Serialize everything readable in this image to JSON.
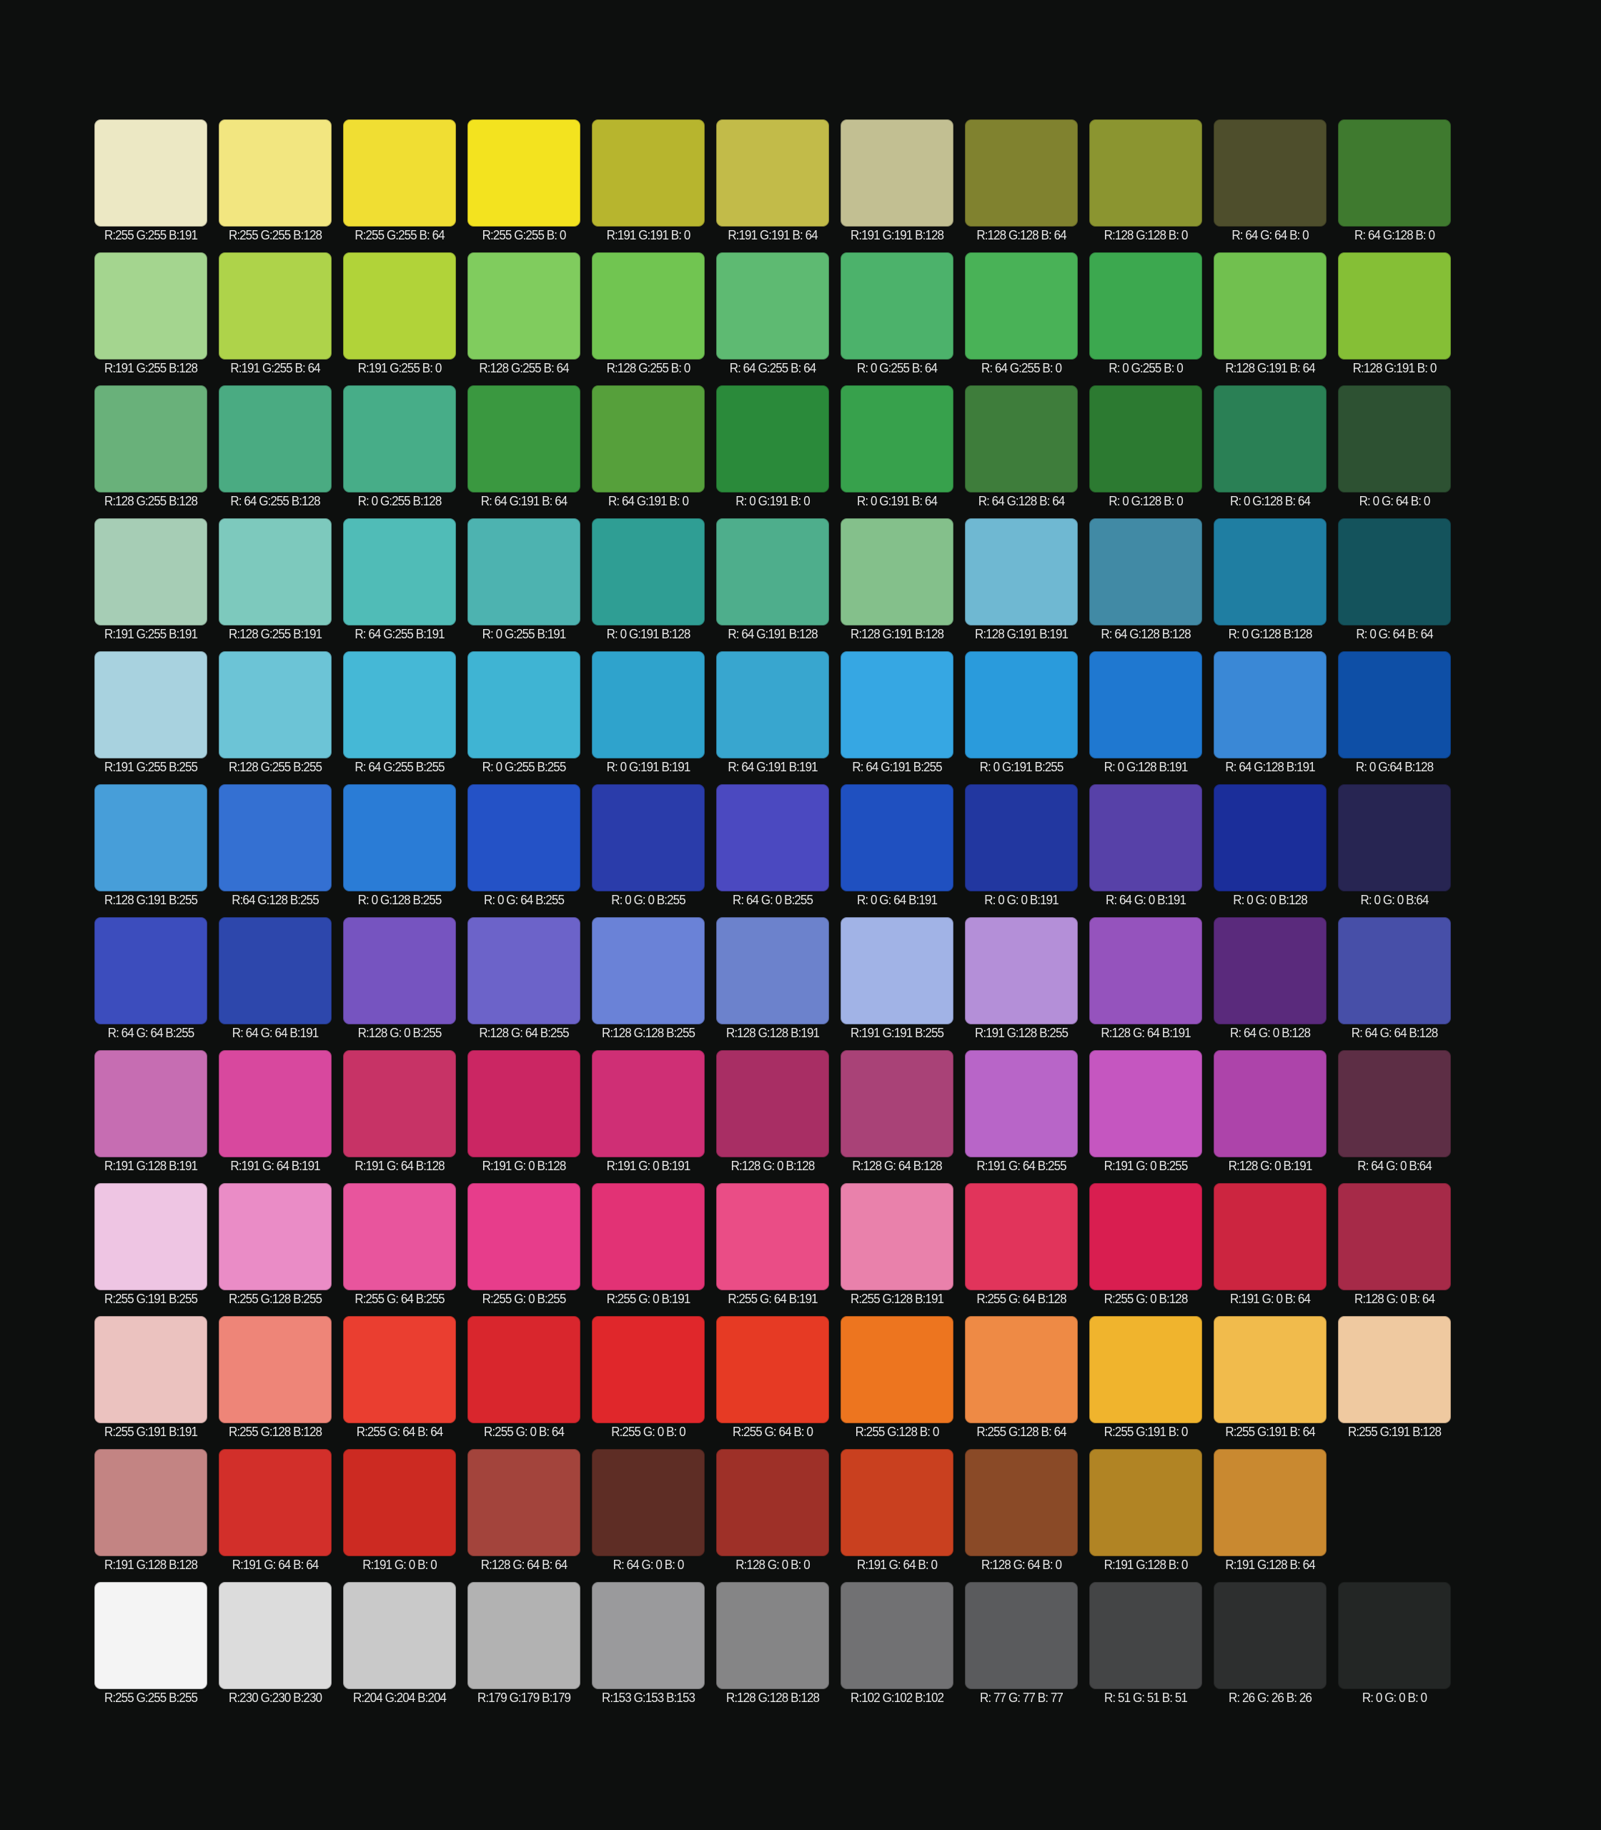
{
  "rows": [
    [
      {
        "label": "R:255 G:255 B:191",
        "color": "#ece8c4"
      },
      {
        "label": "R:255 G:255 B:128",
        "color": "#f2e680"
      },
      {
        "label": "R:255 G:255 B: 64",
        "color": "#f0de33"
      },
      {
        "label": "R:255 G:255 B: 0",
        "color": "#f3e31f"
      },
      {
        "label": "R:191 G:191 B: 0",
        "color": "#b7b52e"
      },
      {
        "label": "R:191 G:191 B: 64",
        "color": "#c2bb49"
      },
      {
        "label": "R:191 G:191 B:128",
        "color": "#c2bf92"
      },
      {
        "label": "R:128 G:128 B: 64",
        "color": "#80822f"
      },
      {
        "label": "R:128 G:128 B: 0",
        "color": "#8b9530"
      },
      {
        "label": "R: 64 G: 64 B: 0",
        "color": "#4e4e2c"
      },
      {
        "label": "R: 64 G:128 B: 0",
        "color": "#3f7a2f"
      }
    ],
    [
      {
        "label": "R:191 G:255 B:128",
        "color": "#a4d58f"
      },
      {
        "label": "R:191 G:255 B: 64",
        "color": "#aed34a"
      },
      {
        "label": "R:191 G:255 B: 0",
        "color": "#b1d339"
      },
      {
        "label": "R:128 G:255 B: 64",
        "color": "#80cc5e"
      },
      {
        "label": "R:128 G:255 B: 0",
        "color": "#71c551"
      },
      {
        "label": "R: 64 G:255 B: 64",
        "color": "#5eba72"
      },
      {
        "label": "R: 0 G:255 B: 64",
        "color": "#4cb26b"
      },
      {
        "label": "R: 64 G:255 B: 0",
        "color": "#49b257"
      },
      {
        "label": "R: 0 G:255 B: 0",
        "color": "#3ca84f"
      },
      {
        "label": "R:128 G:191 B: 64",
        "color": "#71c04f"
      },
      {
        "label": "R:128 G:191 B: 0",
        "color": "#85bf36"
      }
    ],
    [
      {
        "label": "R:128 G:255 B:128",
        "color": "#69b17a"
      },
      {
        "label": "R: 64 G:255 B:128",
        "color": "#4aab82"
      },
      {
        "label": "R: 0 G:255 B:128",
        "color": "#47ad88"
      },
      {
        "label": "R: 64 G:191 B: 64",
        "color": "#3a9840"
      },
      {
        "label": "R: 64 G:191 B: 0",
        "color": "#56a03b"
      },
      {
        "label": "R: 0 G:191 B: 0",
        "color": "#2a8a3a"
      },
      {
        "label": "R: 0 G:191 B: 64",
        "color": "#37a14c"
      },
      {
        "label": "R: 64 G:128 B: 64",
        "color": "#3e7d3b"
      },
      {
        "label": "R: 0 G:128 B: 0",
        "color": "#2c7a31"
      },
      {
        "label": "R: 0 G:128 B: 64",
        "color": "#2a8055"
      },
      {
        "label": "R: 0 G: 64 B: 0",
        "color": "#2d5132"
      }
    ],
    [
      {
        "label": "R:191 G:255 B:191",
        "color": "#a6cdb5"
      },
      {
        "label": "R:128 G:255 B:191",
        "color": "#7dc9bd"
      },
      {
        "label": "R: 64 G:255 B:191",
        "color": "#50bcb7"
      },
      {
        "label": "R: 0 G:255 B:191",
        "color": "#4db3b0"
      },
      {
        "label": "R: 0 G:191 B:128",
        "color": "#2f9e94"
      },
      {
        "label": "R: 64 G:191 B:128",
        "color": "#4eae8c"
      },
      {
        "label": "R:128 G:191 B:128",
        "color": "#84c08b"
      },
      {
        "label": "R:128 G:191 B:191",
        "color": "#6fb8d2"
      },
      {
        "label": "R: 64 G:128 B:128",
        "color": "#418aa5"
      },
      {
        "label": "R: 0 G:128 B:128",
        "color": "#1f7ea2"
      },
      {
        "label": "R: 0 G: 64 B: 64",
        "color": "#14535c"
      }
    ],
    [
      {
        "label": "R:191 G:255 B:255",
        "color": "#a8d2df"
      },
      {
        "label": "R:128 G:255 B:255",
        "color": "#6cc4d6"
      },
      {
        "label": "R: 64 G:255 B:255",
        "color": "#45b8d6"
      },
      {
        "label": "R: 0 G:255 B:255",
        "color": "#3fb4d3"
      },
      {
        "label": "R: 0 G:191 B:191",
        "color": "#2fa3cc"
      },
      {
        "label": "R: 64 G:191 B:191",
        "color": "#38a6cf"
      },
      {
        "label": "R: 64 G:191 B:255",
        "color": "#36a7e3"
      },
      {
        "label": "R: 0 G:191 B:255",
        "color": "#2a9bdc"
      },
      {
        "label": "R: 0 G:128 B:191",
        "color": "#1f78d0"
      },
      {
        "label": "R: 64 G:128 B:191",
        "color": "#3a88d6"
      },
      {
        "label": "R: 0 G:64 B:128",
        "color": "#0e4fa6"
      }
    ],
    [
      {
        "label": "R:128 G:191 B:255",
        "color": "#479ed9"
      },
      {
        "label": "R:64 G:128 B:255",
        "color": "#3470d2"
      },
      {
        "label": "R: 0 G:128 B:255",
        "color": "#2a7cd6"
      },
      {
        "label": "R: 0 G: 64 B:255",
        "color": "#2452c6"
      },
      {
        "label": "R: 0 G: 0 B:255",
        "color": "#2a3caa"
      },
      {
        "label": "R: 64 G: 0 B:255",
        "color": "#4b49c0"
      },
      {
        "label": "R: 0 G: 64 B:191",
        "color": "#1f50c0"
      },
      {
        "label": "R: 0 G: 0 B:191",
        "color": "#2237a0"
      },
      {
        "label": "R: 64 G: 0 B:191",
        "color": "#5741a8"
      },
      {
        "label": "R: 0 G: 0 B:128",
        "color": "#1b2e9a"
      },
      {
        "label": "R: 0 G: 0 B:64",
        "color": "#272552"
      }
    ],
    [
      {
        "label": "R: 64 G: 64 B:255",
        "color": "#3c4dbd"
      },
      {
        "label": "R: 64 G: 64 B:191",
        "color": "#2d47ac"
      },
      {
        "label": "R:128 G: 0 B:255",
        "color": "#7654c0"
      },
      {
        "label": "R:128 G: 64 B:255",
        "color": "#6c63c9"
      },
      {
        "label": "R:128 G:128 B:255",
        "color": "#6a82d7"
      },
      {
        "label": "R:128 G:128 B:191",
        "color": "#6c82cc"
      },
      {
        "label": "R:191 G:191 B:255",
        "color": "#a1b3e6"
      },
      {
        "label": "R:191 G:128 B:255",
        "color": "#b48fd8"
      },
      {
        "label": "R:128 G: 64 B:191",
        "color": "#9553bd"
      },
      {
        "label": "R: 64 G: 0 B:128",
        "color": "#5a2a7c"
      },
      {
        "label": "R: 64 G: 64 B:128",
        "color": "#474fa8"
      }
    ],
    [
      {
        "label": "R:191 G:128 B:191",
        "color": "#c66db2"
      },
      {
        "label": "R:191 G: 64 B:191",
        "color": "#d8489e"
      },
      {
        "label": "R:191 G: 64 B:128",
        "color": "#c73366"
      },
      {
        "label": "R:191 G: 0 B:128",
        "color": "#cb2663"
      },
      {
        "label": "R:191 G: 0 B:191",
        "color": "#cf2f75"
      },
      {
        "label": "R:128 G: 0 B:128",
        "color": "#a82e64"
      },
      {
        "label": "R:128 G: 64 B:128",
        "color": "#a94277"
      },
      {
        "label": "R:191 G: 64 B:255",
        "color": "#b865c8"
      },
      {
        "label": "R:191 G: 0 B:255",
        "color": "#c556c0"
      },
      {
        "label": "R:128 G: 0 B:191",
        "color": "#ad44aa"
      },
      {
        "label": "R: 64 G: 0 B:64",
        "color": "#5d2e45"
      }
    ],
    [
      {
        "label": "R:255 G:191 B:255",
        "color": "#eec5e3"
      },
      {
        "label": "R:255 G:128 B:255",
        "color": "#ea8cc6"
      },
      {
        "label": "R:255 G: 64 B:255",
        "color": "#e8559d"
      },
      {
        "label": "R:255 G: 0 B:255",
        "color": "#e73d8b"
      },
      {
        "label": "R:255 G: 0 B:191",
        "color": "#e23275"
      },
      {
        "label": "R:255 G: 64 B:191",
        "color": "#ea4d86"
      },
      {
        "label": "R:255 G:128 B:191",
        "color": "#e981ab"
      },
      {
        "label": "R:255 G: 64 B:128",
        "color": "#e1345b"
      },
      {
        "label": "R:255 G: 0 B:128",
        "color": "#d91e50"
      },
      {
        "label": "R:191 G: 0 B: 64",
        "color": "#cc2540"
      },
      {
        "label": "R:128 G: 0 B: 64",
        "color": "#a62a48"
      }
    ],
    [
      {
        "label": "R:255 G:191 B:191",
        "color": "#ebc2bf"
      },
      {
        "label": "R:255 G:128 B:128",
        "color": "#ee8578"
      },
      {
        "label": "R:255 G: 64 B: 64",
        "color": "#ea3e30"
      },
      {
        "label": "R:255 G: 0 B: 64",
        "color": "#d9262d"
      },
      {
        "label": "R:255 G: 0 B: 0",
        "color": "#e0272b"
      },
      {
        "label": "R:255 G: 64 B: 0",
        "color": "#e63a24"
      },
      {
        "label": "R:255 G:128 B: 0",
        "color": "#ed751f"
      },
      {
        "label": "R:255 G:128 B: 64",
        "color": "#ee8a45"
      },
      {
        "label": "R:255 G:191 B: 0",
        "color": "#f0b42d"
      },
      {
        "label": "R:255 G:191 B: 64",
        "color": "#f1bb4c"
      },
      {
        "label": "R:255 G:191 B:128",
        "color": "#efc9a0"
      }
    ],
    [
      {
        "label": "R:191 G:128 B:128",
        "color": "#c38483"
      },
      {
        "label": "R:191 G: 64 B: 64",
        "color": "#d22f2a"
      },
      {
        "label": "R:191 G: 0 B: 0",
        "color": "#cc2a22"
      },
      {
        "label": "R:128 G: 64 B: 64",
        "color": "#a3443c"
      },
      {
        "label": "R: 64 G: 0 B: 0",
        "color": "#5e2d25"
      },
      {
        "label": "R:128 G: 0 B: 0",
        "color": "#9e3028"
      },
      {
        "label": "R:191 G: 64 B: 0",
        "color": "#c9401f"
      },
      {
        "label": "R:128 G: 64 B: 0",
        "color": "#8a4a27"
      },
      {
        "label": "R:191 G:128 B: 0",
        "color": "#b18424"
      },
      {
        "label": "R:191 G:128 B: 64",
        "color": "#c98930"
      },
      null
    ],
    [
      {
        "label": "R:255 G:255 B:255",
        "color": "#f4f4f4"
      },
      {
        "label": "R:230 G:230 B:230",
        "color": "#dcdcdc"
      },
      {
        "label": "R:204 G:204 B:204",
        "color": "#c9c9c9"
      },
      {
        "label": "R:179 G:179 B:179",
        "color": "#b2b2b2"
      },
      {
        "label": "R:153 G:153 B:153",
        "color": "#9a9a9c"
      },
      {
        "label": "R:128 G:128 B:128",
        "color": "#858586"
      },
      {
        "label": "R:102 G:102 B:102",
        "color": "#717173"
      },
      {
        "label": "R: 77 G: 77 B: 77",
        "color": "#5a5b5d"
      },
      {
        "label": "R: 51 G: 51 B: 51",
        "color": "#444546"
      },
      {
        "label": "R: 26 G: 26 B: 26",
        "color": "#2d2f2f"
      },
      {
        "label": "R: 0 G: 0 B: 0",
        "color": "#232625"
      }
    ]
  ]
}
